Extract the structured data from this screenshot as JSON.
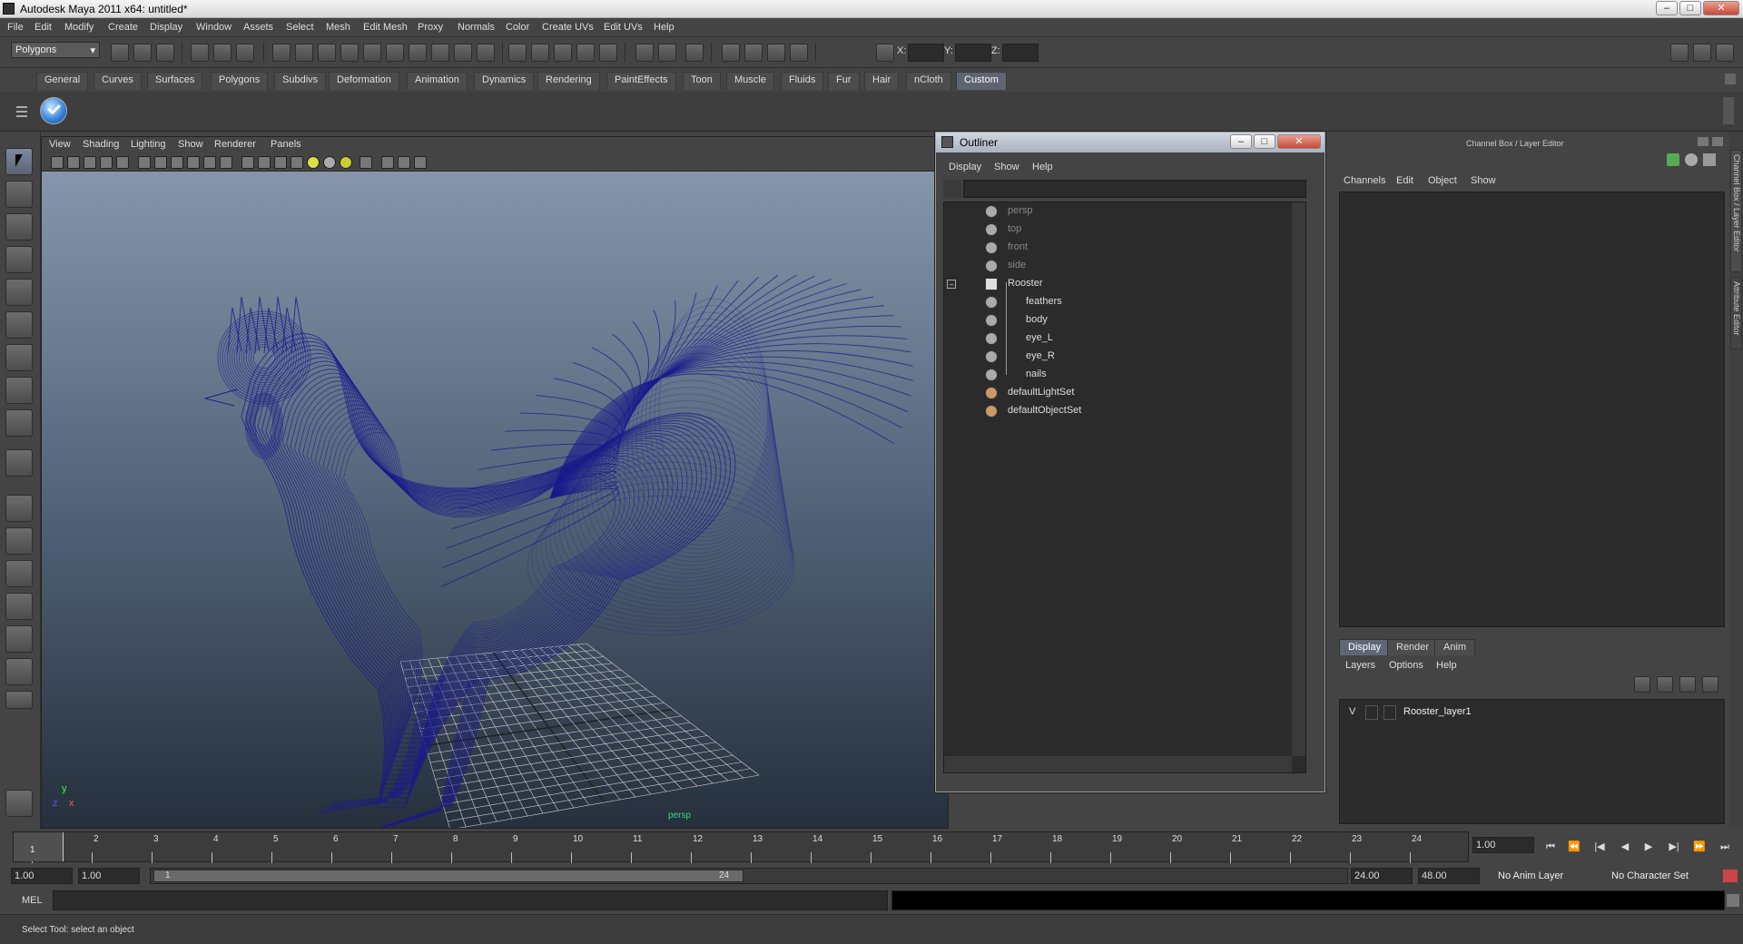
{
  "window": {
    "title": "Autodesk Maya 2011 x64: untitled*"
  },
  "menubar": [
    "File",
    "Edit",
    "Modify",
    "Create",
    "Display",
    "Window",
    "Assets",
    "Select",
    "Mesh",
    "Edit Mesh",
    "Proxy",
    "Normals",
    "Color",
    "Create UVs",
    "Edit UVs",
    "Help"
  ],
  "statusline": {
    "mode": "Polygons",
    "x_label": "X:",
    "y_label": "Y:",
    "z_label": "Z:"
  },
  "shelf_tabs": [
    "General",
    "Curves",
    "Surfaces",
    "Polygons",
    "Subdivs",
    "Deformation",
    "Animation",
    "Dynamics",
    "Rendering",
    "PaintEffects",
    "Toon",
    "Muscle",
    "Fluids",
    "Fur",
    "Hair",
    "nCloth",
    "Custom"
  ],
  "shelf_active": "Custom",
  "viewport": {
    "menus": [
      "View",
      "Shading",
      "Lighting",
      "Show",
      "Renderer",
      "Panels"
    ],
    "camera_label": "persp",
    "axis_y": "y",
    "axis_x": "x",
    "axis_z": "z",
    "wire_color": "#1a1a8c"
  },
  "outliner": {
    "title": "Outliner",
    "menus": [
      "Display",
      "Show",
      "Help"
    ],
    "items": [
      {
        "label": "persp",
        "type": "camera",
        "dim": true
      },
      {
        "label": "top",
        "type": "camera",
        "dim": true
      },
      {
        "label": "front",
        "type": "camera",
        "dim": true
      },
      {
        "label": "side",
        "type": "camera",
        "dim": true
      },
      {
        "label": "Rooster",
        "type": "group",
        "dim": false
      },
      {
        "label": "feathers",
        "type": "mesh",
        "dim": false
      },
      {
        "label": "body",
        "type": "mesh",
        "dim": false
      },
      {
        "label": "eye_L",
        "type": "mesh",
        "dim": false
      },
      {
        "label": "eye_R",
        "type": "mesh",
        "dim": false
      },
      {
        "label": "nails",
        "type": "mesh",
        "dim": false
      },
      {
        "label": "defaultLightSet",
        "type": "set",
        "dim": false
      },
      {
        "label": "defaultObjectSet",
        "type": "set",
        "dim": false
      }
    ]
  },
  "channelbox": {
    "title": "Channel Box / Layer Editor",
    "menus": [
      "Channels",
      "Edit",
      "Object",
      "Show"
    ],
    "layer_tabs": [
      "Display",
      "Render",
      "Anim"
    ],
    "layer_menus": [
      "Layers",
      "Options",
      "Help"
    ],
    "layer": {
      "visibility": "V",
      "name": "Rooster_layer1"
    },
    "side_tabs": [
      "Channel Box / Layer Editor",
      "Attribute Editor"
    ]
  },
  "timeline": {
    "ticks": [
      "1",
      "2",
      "3",
      "4",
      "5",
      "6",
      "7",
      "8",
      "9",
      "10",
      "11",
      "12",
      "13",
      "14",
      "15",
      "16",
      "17",
      "18",
      "19",
      "20",
      "21",
      "22",
      "23",
      "24"
    ],
    "current_frame_field": "1.00",
    "current_frame_marker": "1"
  },
  "range": {
    "start": "1.00",
    "playback_start": "1.00",
    "range_start": "1",
    "range_end": "24",
    "playback_end": "24.00",
    "end": "48.00",
    "anim_layer": "No Anim Layer",
    "character_set": "No Character Set"
  },
  "command": {
    "label": "MEL"
  },
  "help": {
    "text": "Select Tool: select an object"
  }
}
